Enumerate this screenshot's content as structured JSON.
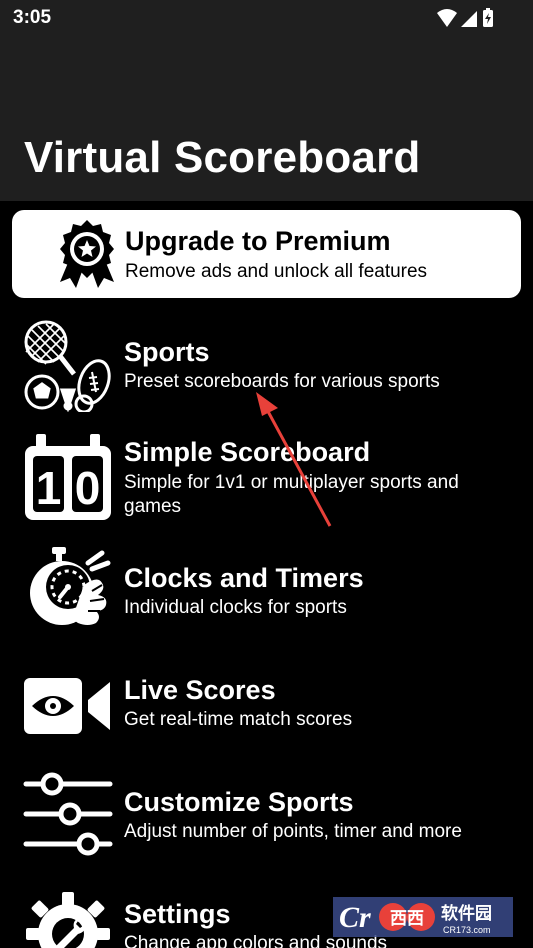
{
  "status_bar": {
    "time": "3:05",
    "icons": [
      "wifi-icon",
      "signal-icon",
      "battery-charging-icon"
    ]
  },
  "app": {
    "title": "Virtual Scoreboard"
  },
  "premium": {
    "icon": "award-ribbon-icon",
    "title": "Upgrade to Premium",
    "subtitle": "Remove ads and unlock all features"
  },
  "menu": {
    "items": [
      {
        "icon": "sports-equipment-icon",
        "title": "Sports",
        "subtitle": "Preset scoreboards for various sports"
      },
      {
        "icon": "scoreboard-icon",
        "title": "Simple Scoreboard",
        "subtitle": "Simple for 1v1 or multiplayer sports and games"
      },
      {
        "icon": "stopwatch-hand-icon",
        "title": "Clocks and Timers",
        "subtitle": "Individual clocks for sports"
      },
      {
        "icon": "video-camera-icon",
        "title": "Live Scores",
        "subtitle": "Get real-time match scores"
      },
      {
        "icon": "sliders-icon",
        "title": "Customize Sports",
        "subtitle": "Adjust number of points, timer and more"
      },
      {
        "icon": "gear-wrench-icon",
        "title": "Settings",
        "subtitle": "Change app colors and sounds"
      }
    ]
  },
  "scoreboard_icon_digits": [
    "1",
    "0"
  ],
  "watermark": {
    "logo_text": "Cr",
    "brand": "西西",
    "cn_text": "软件园",
    "url": "CR173.com"
  },
  "colors": {
    "background": "#000000",
    "header": "#1f1f1f",
    "card": "#ffffff",
    "text": "#ffffff",
    "annotation": "#e8413a"
  }
}
